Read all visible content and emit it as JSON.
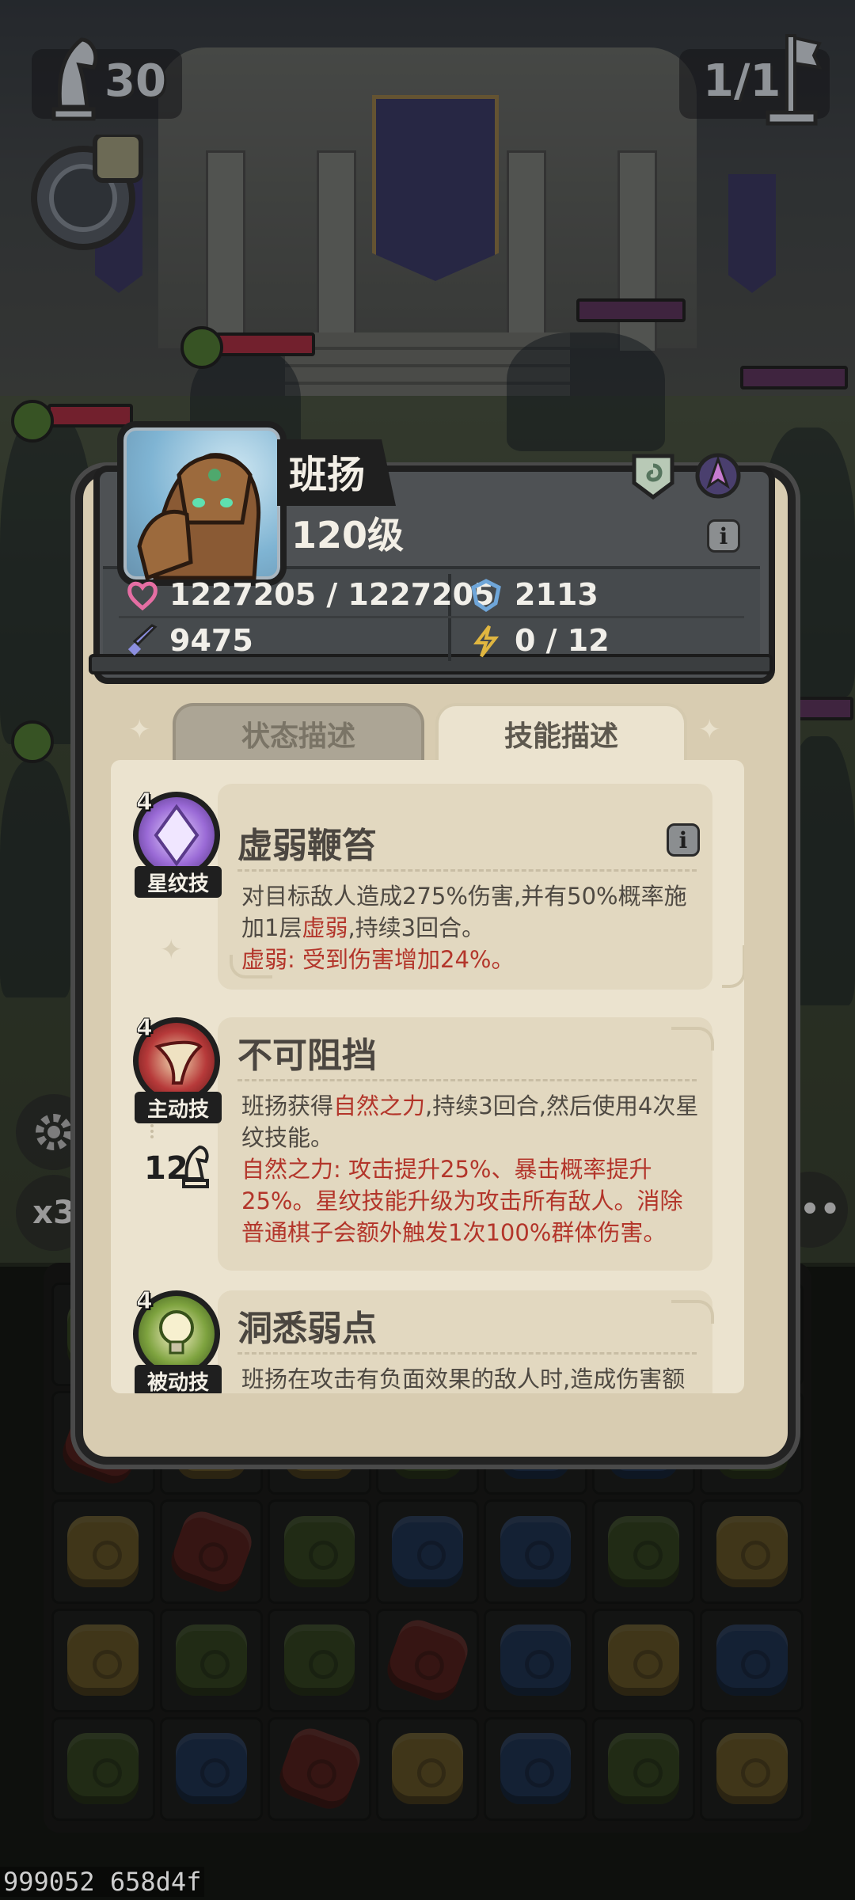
{
  "hud": {
    "moves": "30",
    "wave": "1/1"
  },
  "hero": {
    "name": "班扬",
    "level": "120级",
    "hp": "1227205 / 1227205",
    "defense": "2113",
    "attack": "9475",
    "energy": "0 / 12"
  },
  "tabs": {
    "status": "状态描述",
    "skills": "技能描述",
    "active": "skills"
  },
  "skills": [
    {
      "name": "虚弱鞭笞",
      "level": "4",
      "type": "星纹技",
      "desc_parts": [
        "对目标敌人造成275%伤害,并有50%概率施加1层",
        "虚弱",
        ",持续3回合。"
      ],
      "note": "虚弱: 受到伤害增加24%。",
      "color": "#8d63c8"
    },
    {
      "name": "不可阻挡",
      "level": "4",
      "type": "主动技",
      "cost": "12",
      "desc_parts": [
        "班扬获得",
        "自然之力",
        ",持续3回合,然后使用4次星纹技能。"
      ],
      "note": "自然之力: 攻击提升25%、暴击概率提升25%。星纹技能升级为攻击所有敌人。消除普通棋子会额外触发1次100%群体伤害。",
      "color": "#a4262c"
    },
    {
      "name": "洞悉弱点",
      "level": "4",
      "type": "被动技",
      "desc": "班扬在攻击有负面效果的敌人时,造成伤害额",
      "color": "#5f7f2e"
    }
  ],
  "side_buttons": {
    "speed": "x3",
    "more": "•••"
  },
  "debug": "999052 658d4f",
  "colors": {
    "highlight": "#b3352a",
    "panel": "#ebe3cf",
    "header": "#4e5154"
  },
  "icons": {
    "hp": "heart-icon",
    "defense": "shield-icon",
    "attack": "sword-icon",
    "energy": "lightning-icon"
  }
}
